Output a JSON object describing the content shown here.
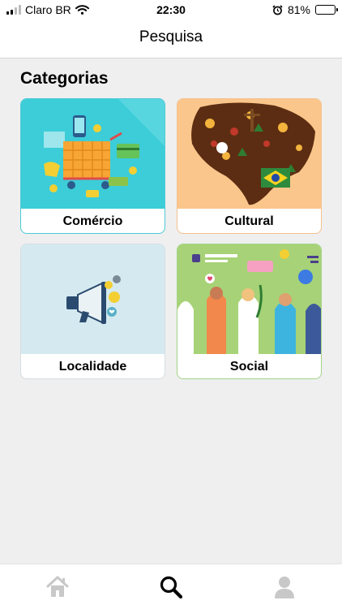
{
  "status": {
    "carrier": "Claro BR",
    "time": "22:30",
    "battery_percent": "81%",
    "battery_level": 0.81
  },
  "header": {
    "title": "Pesquisa"
  },
  "main": {
    "section_title": "Categorias",
    "categories": [
      {
        "label": "Comércio",
        "accent": "#3ccdd8"
      },
      {
        "label": "Cultural",
        "accent": "#fbc68b"
      },
      {
        "label": "Localidade",
        "accent": "#d5eaf0"
      },
      {
        "label": "Social",
        "accent": "#a7d277"
      }
    ]
  },
  "tabbar": {
    "items": [
      {
        "icon": "home-icon",
        "active": false
      },
      {
        "icon": "search-icon",
        "active": true
      },
      {
        "icon": "person-icon",
        "active": false
      }
    ]
  }
}
